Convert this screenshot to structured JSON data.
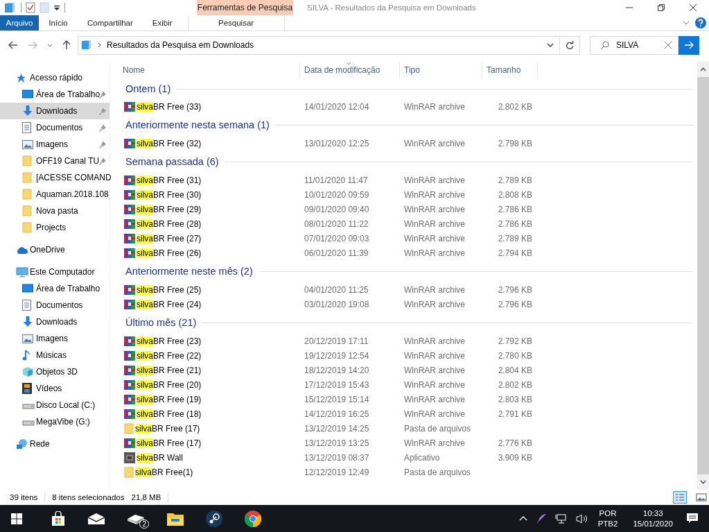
{
  "window": {
    "title": "SILVA - Resultados da Pesquisa em Downloads",
    "context_tab": "Ferramentas de Pesquisa"
  },
  "ribbon_tabs": [
    {
      "label": "Arquivo",
      "kind": "file",
      "selected": false
    },
    {
      "label": "Início",
      "kind": "tab",
      "selected": false
    },
    {
      "label": "Compartilhar",
      "kind": "tab",
      "selected": false
    },
    {
      "label": "Exibir",
      "kind": "tab",
      "selected": false
    },
    {
      "label": "Pesquisar",
      "kind": "context",
      "selected": true
    }
  ],
  "address": {
    "path": "Resultados da Pesquisa em Downloads"
  },
  "search": {
    "value": "SILVA"
  },
  "sidebar": [
    {
      "label": "Acesso rápido",
      "kind": "star",
      "selected": false,
      "children": [
        {
          "label": "Área de Trabalho",
          "kind": "desktop",
          "pinned": true,
          "selected": false
        },
        {
          "label": "Downloads",
          "kind": "download",
          "pinned": true,
          "selected": true
        },
        {
          "label": "Documentos",
          "kind": "doc",
          "pinned": true,
          "selected": false
        },
        {
          "label": "Imagens",
          "kind": "image",
          "pinned": true,
          "selected": false
        },
        {
          "label": "OFF19 Canal  TU",
          "kind": "folder",
          "pinned": true,
          "selected": false
        },
        {
          "label": "[ACESSE COMAND",
          "kind": "folder",
          "pinned": false,
          "selected": false
        },
        {
          "label": "Aquaman.2018.108",
          "kind": "folder",
          "pinned": false,
          "selected": false
        },
        {
          "label": "Nova pasta",
          "kind": "folder",
          "pinned": false,
          "selected": false
        },
        {
          "label": "Projects",
          "kind": "folder",
          "pinned": false,
          "selected": false
        }
      ]
    },
    {
      "label": "OneDrive",
      "kind": "cloud",
      "selected": false
    },
    {
      "label": "Este Computador",
      "kind": "pc",
      "selected": false,
      "children": [
        {
          "label": "Área de Trabalho",
          "kind": "desktop",
          "pinned": false,
          "selected": false
        },
        {
          "label": "Documentos",
          "kind": "doc",
          "pinned": false,
          "selected": false
        },
        {
          "label": "Downloads",
          "kind": "download",
          "pinned": false,
          "selected": false
        },
        {
          "label": "Imagens",
          "kind": "image",
          "pinned": false,
          "selected": false
        },
        {
          "label": "Músicas",
          "kind": "music",
          "pinned": false,
          "selected": false
        },
        {
          "label": "Objetos 3D",
          "kind": "cube",
          "pinned": false,
          "selected": false
        },
        {
          "label": "Vídeos",
          "kind": "film",
          "pinned": false,
          "selected": false
        },
        {
          "label": "Disco Local (C:)",
          "kind": "drive",
          "pinned": false,
          "selected": false
        },
        {
          "label": "MegaVibe (G:)",
          "kind": "drive",
          "pinned": false,
          "selected": false
        }
      ]
    },
    {
      "label": "Rede",
      "kind": "network",
      "selected": false
    }
  ],
  "columns": [
    "Nome",
    "Data de modificação",
    "Tipo",
    "Tamanho"
  ],
  "groups": [
    {
      "title": "Ontem (1)",
      "rows": [
        {
          "kind": "rar",
          "match": "silva",
          "rest": "BR Free (33)",
          "date": "14/01/2020 12:04",
          "type": "WinRAR archive",
          "size": "2.802 KB"
        }
      ]
    },
    {
      "title": "Anteriormente nesta semana (1)",
      "rows": [
        {
          "kind": "rar",
          "match": "silva",
          "rest": "BR Free (32)",
          "date": "13/01/2020 12:25",
          "type": "WinRAR archive",
          "size": "2.798 KB"
        }
      ]
    },
    {
      "title": "Semana passada (6)",
      "rows": [
        {
          "kind": "rar",
          "match": "silva",
          "rest": "BR Free (31)",
          "date": "11/01/2020 11:47",
          "type": "WinRAR archive",
          "size": "2.789 KB"
        },
        {
          "kind": "rar",
          "match": "silva",
          "rest": "BR Free (30)",
          "date": "10/01/2020 09:59",
          "type": "WinRAR archive",
          "size": "2.808 KB"
        },
        {
          "kind": "rar",
          "match": "silva",
          "rest": "BR Free (29)",
          "date": "09/01/2020 09:40",
          "type": "WinRAR archive",
          "size": "2.786 KB"
        },
        {
          "kind": "rar",
          "match": "silva",
          "rest": "BR Free (28)",
          "date": "08/01/2020 11:22",
          "type": "WinRAR archive",
          "size": "2.786 KB"
        },
        {
          "kind": "rar",
          "match": "silva",
          "rest": "BR Free (27)",
          "date": "07/01/2020 09:03",
          "type": "WinRAR archive",
          "size": "2.789 KB"
        },
        {
          "kind": "rar",
          "match": "silva",
          "rest": "BR Free (26)",
          "date": "06/01/2020 11:39",
          "type": "WinRAR archive",
          "size": "2.794 KB"
        }
      ]
    },
    {
      "title": "Anteriormente neste mês (2)",
      "rows": [
        {
          "kind": "rar",
          "match": "silva",
          "rest": "BR Free (25)",
          "date": "04/01/2020 11:25",
          "type": "WinRAR archive",
          "size": "2.796 KB"
        },
        {
          "kind": "rar",
          "match": "silva",
          "rest": "BR Free (24)",
          "date": "03/01/2020 19:08",
          "type": "WinRAR archive",
          "size": "2.796 KB"
        }
      ]
    },
    {
      "title": "Último mês (21)",
      "rows": [
        {
          "kind": "rar",
          "match": "silva",
          "rest": "BR Free (23)",
          "date": "20/12/2019 17:11",
          "type": "WinRAR archive",
          "size": "2.792 KB"
        },
        {
          "kind": "rar",
          "match": "silva",
          "rest": "BR Free (22)",
          "date": "19/12/2019 12:54",
          "type": "WinRAR archive",
          "size": "2.780 KB"
        },
        {
          "kind": "rar",
          "match": "silva",
          "rest": "BR Free (21)",
          "date": "18/12/2019 14:20",
          "type": "WinRAR archive",
          "size": "2.804 KB"
        },
        {
          "kind": "rar",
          "match": "silva",
          "rest": "BR Free (20)",
          "date": "17/12/2019 15:43",
          "type": "WinRAR archive",
          "size": "2.802 KB"
        },
        {
          "kind": "rar",
          "match": "silva",
          "rest": "BR Free (19)",
          "date": "15/12/2019 15:14",
          "type": "WinRAR archive",
          "size": "2.803 KB"
        },
        {
          "kind": "rar",
          "match": "silva",
          "rest": "BR Free (18)",
          "date": "14/12/2019 16:25",
          "type": "WinRAR archive",
          "size": "2.791 KB"
        },
        {
          "kind": "folder",
          "match": "silva",
          "rest": "BR Free (17)",
          "date": "13/12/2019 14:25",
          "type": "Pasta de arquivos"
        },
        {
          "kind": "rar",
          "match": "silva",
          "rest": "BR Free (17)",
          "date": "13/12/2019 13:25",
          "type": "WinRAR archive",
          "size": "2.776 KB"
        },
        {
          "kind": "app",
          "match": "silva",
          "rest": "BR Wall",
          "date": "13/12/2019 08:37",
          "type": "Aplicativo",
          "size": "3.909 KB"
        },
        {
          "kind": "folder",
          "match": "silva",
          "rest": "BR Free(1)",
          "date": "12/12/2019 12:49",
          "type": "Pasta de arquivos"
        }
      ]
    }
  ],
  "status_bar": {
    "count": "39 itens",
    "selection": "8 itens selecionados",
    "size": "21,8 MB"
  },
  "taskbar": {
    "badge": "2",
    "lang": "POR",
    "layout": "PTB2",
    "time": "10:33",
    "date": "15/01/2020"
  }
}
